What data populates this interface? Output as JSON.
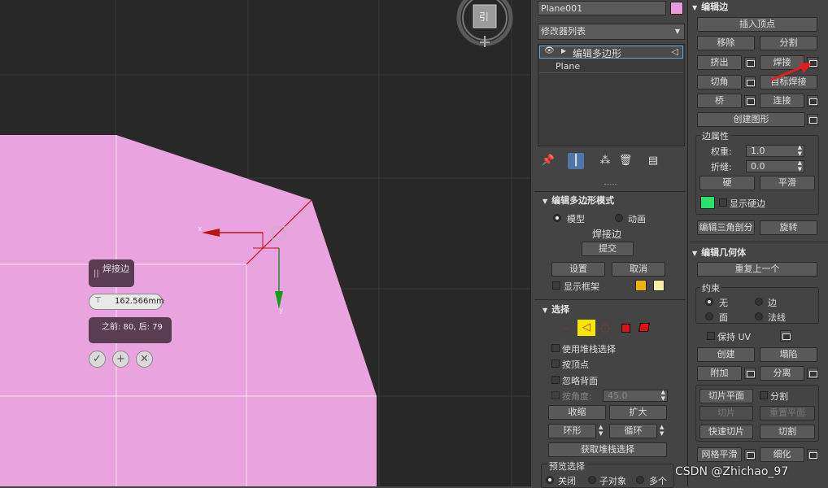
{
  "viewport": {
    "caddy": {
      "title": "焊接边",
      "grip": "||",
      "input_value": "162.566mm",
      "info": "之前: 80, 后: 79",
      "ok_icon": "check-icon",
      "apply_icon": "plus-icon",
      "cancel_icon": "x-icon"
    },
    "gizmo_x": "x",
    "gizmo_y": "y",
    "viewcube_label": "引",
    "object_color": "#e9a3de"
  },
  "panel": {
    "object_name": "Plane001",
    "object_color": "#e99ad9",
    "modifier_list": "修改器列表",
    "stack": [
      {
        "label": "编辑多边形",
        "selected": true
      },
      {
        "label": "Plane",
        "selected": false
      }
    ],
    "poly_mode": {
      "title": "编辑多边形模式",
      "model": "模型",
      "anim": "动画",
      "current_op": "焊接边",
      "commit": "提交",
      "settings": "设置",
      "cancel": "取消",
      "show_cage": "显示框架",
      "cage_colors": [
        "#f1b300",
        "#f3f0a2"
      ]
    },
    "selection": {
      "title": "选择",
      "use_stack": "使用堆栈选择",
      "by_vertex": "按顶点",
      "ignore_backface": "忽略背面",
      "by_angle": "按角度:",
      "angle_value": "45.0",
      "shrink": "收缩",
      "grow": "扩大",
      "ring": "环形",
      "loop": "循环",
      "get_stack": "获取堆栈选择",
      "preview": "预览选择",
      "preview_off": "关闭",
      "preview_sub": "子对象",
      "preview_multi": "多个"
    }
  },
  "edit_edges": {
    "title": "编辑边",
    "insert_vertex": "插入顶点",
    "remove": "移除",
    "split": "分割",
    "extrude": "挤出",
    "weld": "焊接",
    "chamfer": "切角",
    "target_weld": "目标焊接",
    "bridge": "桥",
    "connect": "连接",
    "create_shape": "创建图形",
    "edge_props": "边属性",
    "weight_label": "权重:",
    "weight_value": "1.0",
    "crease_label": "折缝:",
    "crease_value": "0.0",
    "hard": "硬",
    "smooth": "平滑",
    "hard_color": "#2de06b",
    "show_hard": "显示硬边",
    "edit_tri": "编辑三角剖分",
    "turn": "旋转"
  },
  "edit_geom": {
    "title": "编辑几何体",
    "repeat_last": "重复上一个",
    "constraints": "约束",
    "none": "无",
    "edge": "边",
    "face": "面",
    "normal": "法线",
    "preserve_uv": "保持 UV",
    "create": "创建",
    "collapse": "塌陷",
    "attach": "附加",
    "detach": "分离",
    "slice_plane": "切片平面",
    "split": "分割",
    "slice": "切片",
    "reset_plane": "重置平面",
    "quick_slice": "快速切片",
    "cut": "切割",
    "meshsmooth": "网格平滑",
    "tessellate": "细化"
  },
  "watermark": "CSDN @Zhichao_97"
}
